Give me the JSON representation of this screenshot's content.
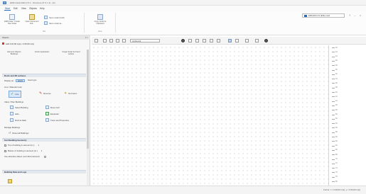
{
  "window": {
    "title": "EMS Cadd 2024 2.5.1 - Structure (IT 6 x 4) - [C]"
  },
  "menu": [
    {
      "label": "Start",
      "active": true
    },
    {
      "label": "Edit",
      "active": false
    },
    {
      "label": "View",
      "active": false
    },
    {
      "label": "Objects",
      "active": false
    },
    {
      "label": "Help",
      "active": false
    }
  ],
  "ribbon": {
    "group1": {
      "label": "File",
      "buttons": [
        {
          "label": "EMS Data / Create New Initial",
          "icon": "new-file-icon"
        },
        {
          "label": "Open Document Full...",
          "icon": "open-folder-icon"
        }
      ],
      "small": [
        {
          "label": "Save model (CAD)",
          "icon": "save-icon"
        },
        {
          "label": "Save model as...",
          "icon": "save-as-icon"
        }
      ]
    },
    "group2": {
      "label": "View",
      "buttons": [
        {
          "label": "Copy model to Clipboard",
          "icon": "clipboard-icon"
        }
      ]
    }
  },
  "profile": {
    "label": "EMS-ENV-CS (EXE) used"
  },
  "panel": {
    "title": "Objects",
    "selector": "wall 2,40,00 m(s) x 4.00,00 m(s)",
    "tabs": [
      "Element Objects Buildings",
      "Vector Application",
      "Single Scale Surf and surface"
    ],
    "sections": {
      "roof": "Roofs and 3D surfaces",
      "sort": "Sort Building Geometry",
      "base": "Building Data and Logs"
    },
    "display_as_label": "Display as:",
    "display_options": [
      "Height",
      "Exact type"
    ],
    "line_type_label": "Line / Material Color",
    "line_tools": [
      "Line",
      "Reverse",
      "No button"
    ],
    "build_label": "Class / Plan Buildings",
    "build_tools": [
      "Select Building",
      "Move Cell",
      "Hide",
      "Expander",
      "Roof-to-Main",
      "Trace and Properties"
    ],
    "manage_label": "Manage Buildings",
    "manage_item": "Reset all Buildings",
    "sort_items": [
      "Top of building in element (Lt.)",
      "Bottom of building in element (Lt.)",
      "Use absolute values (not follow derived)"
    ],
    "sort_values": [
      "1",
      "1"
    ]
  },
  "toolbar": {
    "combo": "Verified All"
  },
  "ruler": [
    "20",
    "22",
    "24",
    "26",
    "28",
    "30",
    "32",
    "34",
    "36",
    "38",
    "40",
    "42",
    "44",
    "46",
    "48",
    "50",
    "52",
    "54",
    "56",
    "58",
    "60",
    "62",
    "64",
    "66",
    "68",
    "70",
    "72",
    "74",
    "76",
    "78",
    "80"
  ],
  "status": {
    "text": "Cursor: x = 0.00,00 m(s), y = 0.00,00 m(s)"
  }
}
